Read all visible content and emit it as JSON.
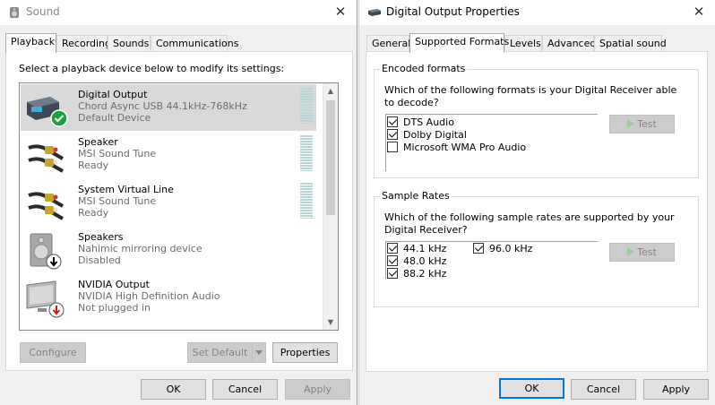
{
  "sound": {
    "title": "Sound",
    "tabs": [
      "Playback",
      "Recording",
      "Sounds",
      "Communications"
    ],
    "instruction": "Select a playback device below to modify its settings:",
    "devices": [
      {
        "name": "Digital Output",
        "desc": "Chord Async USB 44.1kHz-768kHz",
        "status": "Default Device"
      },
      {
        "name": "Speaker",
        "desc": "MSI Sound Tune",
        "status": "Ready"
      },
      {
        "name": "System Virtual Line",
        "desc": "MSI Sound Tune",
        "status": "Ready"
      },
      {
        "name": "Speakers",
        "desc": "Nahimic mirroring device",
        "status": "Disabled"
      },
      {
        "name": "NVIDIA Output",
        "desc": "NVIDIA High Definition Audio",
        "status": "Not plugged in"
      }
    ],
    "buttons": {
      "configure": "Configure",
      "set_default": "Set Default",
      "properties": "Properties",
      "ok": "OK",
      "cancel": "Cancel",
      "apply": "Apply"
    }
  },
  "props": {
    "title": "Digital Output Properties",
    "tabs": [
      "General",
      "Supported Formats",
      "Levels",
      "Advanced",
      "Spatial sound"
    ],
    "encoded": {
      "title": "Encoded formats",
      "question": "Which of the following formats is your Digital Receiver able to decode?",
      "formats": [
        {
          "label": "DTS Audio",
          "checked": true
        },
        {
          "label": "Dolby Digital",
          "checked": true
        },
        {
          "label": "Microsoft WMA Pro Audio",
          "checked": false
        }
      ],
      "test": "Test"
    },
    "rates": {
      "title": "Sample Rates",
      "question": "Which of the following sample rates are supported by your Digital Receiver?",
      "items": [
        {
          "label": "44.1 kHz",
          "checked": true
        },
        {
          "label": "48.0 kHz",
          "checked": true
        },
        {
          "label": "88.2 kHz",
          "checked": true
        },
        {
          "label": "96.0 kHz",
          "checked": true
        }
      ],
      "test": "Test"
    },
    "buttons": {
      "ok": "OK",
      "cancel": "Cancel",
      "apply": "Apply"
    }
  },
  "icons": {
    "sound_app": "speaker-app-icon",
    "props_app": "digital-output-icon",
    "close": "close-icon"
  }
}
